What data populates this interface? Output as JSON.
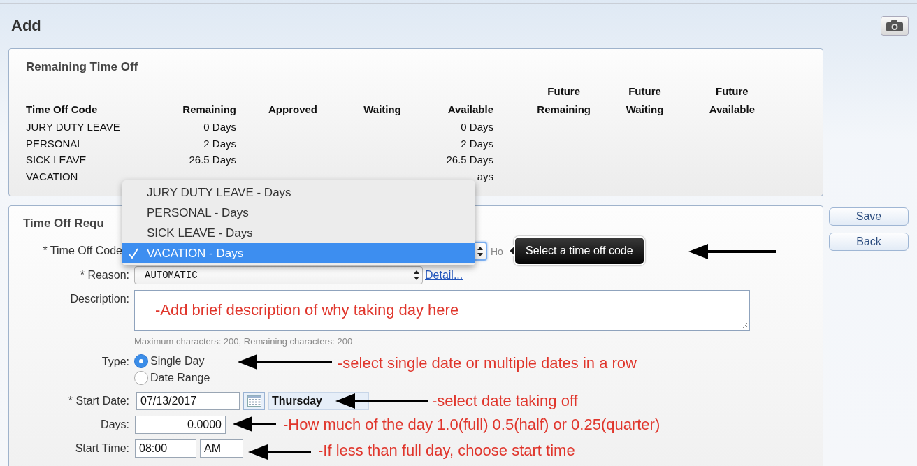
{
  "header": {
    "title": "Add"
  },
  "remaining_time_off": {
    "title": "Remaining Time Off",
    "columns": [
      "Time Off Code",
      "Remaining",
      "Approved",
      "Waiting",
      "Available",
      "Future Remaining",
      "Future Waiting",
      "Future Available"
    ],
    "rows": [
      {
        "cells": [
          "JURY DUTY LEAVE",
          "0 Days",
          null,
          null,
          "0 Days",
          null,
          null,
          null
        ]
      },
      {
        "cells": [
          "PERSONAL",
          "2 Days",
          null,
          null,
          "2 Days",
          null,
          null,
          null
        ]
      },
      {
        "cells": [
          "SICK LEAVE",
          "26.5 Days",
          null,
          null,
          "26.5 Days",
          null,
          null,
          null
        ]
      },
      {
        "cells": [
          "VACATION",
          null,
          null,
          null,
          "ays",
          null,
          null,
          null
        ]
      }
    ]
  },
  "time_off_request": {
    "title": "Time Off Requ",
    "fields": [
      {
        "kind": "select",
        "label": "* Time Off Code",
        "focused": true,
        "after": "Ho"
      },
      {
        "kind": "select",
        "label": "* Reason:",
        "focused": false,
        "value": "AUTOMATIC",
        "link": "Detail..."
      },
      {
        "kind": "textarea",
        "label": "Description:",
        "hint": "Maximum characters: 200, Remaining characters: 200"
      },
      {
        "kind": "radio",
        "label": "Type:",
        "options": [
          {
            "label": "Single Day",
            "selected": true
          },
          {
            "label": "Date Range",
            "selected": false
          }
        ]
      },
      {
        "kind": "date",
        "label": "* Start Date:",
        "value": "07/13/2017",
        "weekday": "Thursday"
      },
      {
        "kind": "number",
        "label": "Days:",
        "value": "0.0000"
      },
      {
        "kind": "time",
        "label": "Start Time:",
        "value": "08:00",
        "period": "AM"
      }
    ]
  },
  "code_menu": {
    "items": [
      {
        "label": "JURY DUTY LEAVE - Days",
        "selected": false
      },
      {
        "label": "PERSONAL - Days",
        "selected": false
      },
      {
        "label": "SICK LEAVE - Days",
        "selected": false
      },
      {
        "label": "VACATION - Days",
        "selected": true
      }
    ]
  },
  "buttons": [
    "Save",
    "Back"
  ],
  "annotations": [
    {
      "kind": "tooltip",
      "text": "Select a time off code",
      "arrow": true
    },
    {
      "kind": "note",
      "text": "-Add brief description of why taking day here",
      "arrow": false
    },
    {
      "kind": "note",
      "text": "-select single date or multiple dates in a row",
      "arrow": true
    },
    {
      "kind": "note",
      "text": "-select date taking off",
      "arrow": true
    },
    {
      "kind": "note",
      "text": "-How much of the day 1.0(full) 0.5(half) or 0.25(quarter)",
      "arrow": true
    },
    {
      "kind": "note",
      "text": "-If less than full day, choose start time",
      "arrow": true
    }
  ]
}
